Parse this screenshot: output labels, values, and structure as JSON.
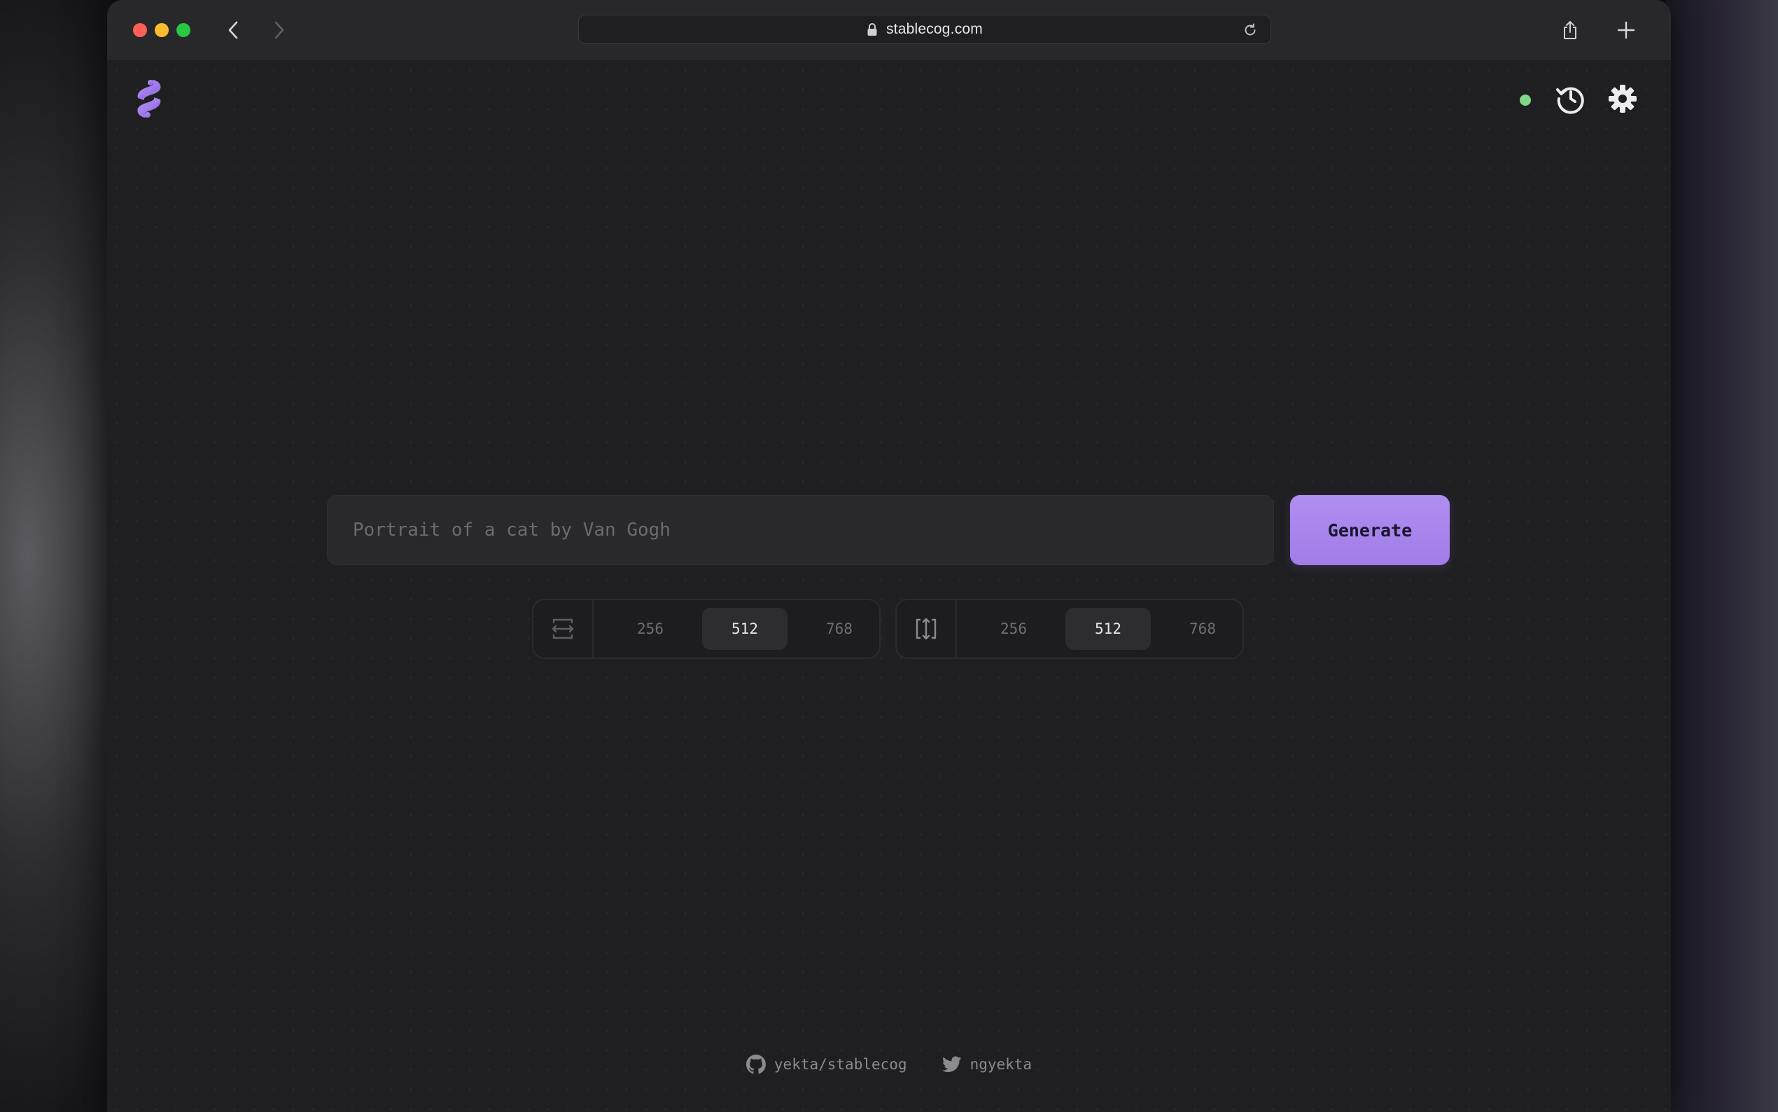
{
  "browser": {
    "url": "stablecog.com",
    "icons": {
      "back": "chevron-left-icon",
      "forward": "chevron-right-icon",
      "lock": "lock-icon",
      "reload": "reload-icon",
      "share": "share-icon",
      "new_tab": "plus-icon"
    }
  },
  "header": {
    "logo": "stablecog-logo",
    "status_color": "#7fd987",
    "icons": [
      "history-icon",
      "gear-icon"
    ]
  },
  "prompt": {
    "placeholder": "Portrait of a cat by Van Gogh",
    "value": ""
  },
  "generate_button": {
    "label": "Generate",
    "color": "#a685ee"
  },
  "width_selector": {
    "icon": "width-arrows-icon",
    "options": [
      "256",
      "512",
      "768"
    ],
    "selected": "512"
  },
  "height_selector": {
    "icon": "height-arrows-icon",
    "options": [
      "256",
      "512",
      "768"
    ],
    "selected": "512"
  },
  "footer": {
    "github": {
      "label": "yekta/stablecog",
      "icon": "github-icon"
    },
    "twitter": {
      "label": "ngyekta",
      "icon": "twitter-icon"
    }
  }
}
